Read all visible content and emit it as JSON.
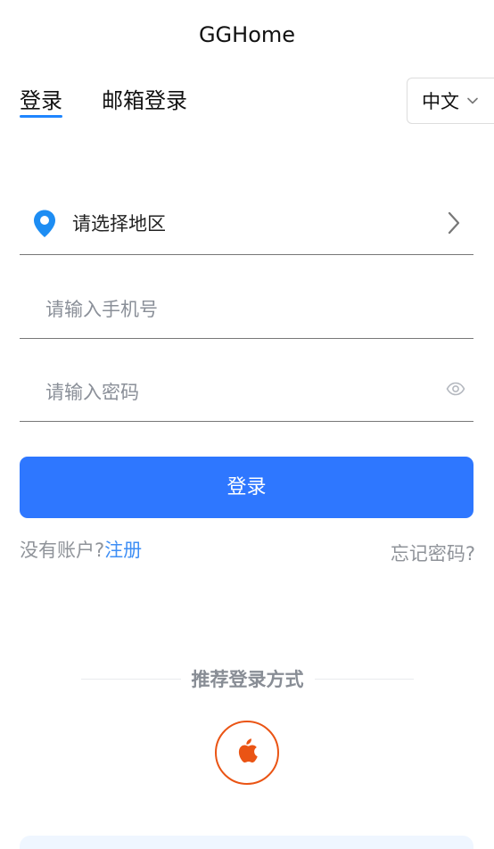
{
  "app": {
    "title": "GGHome"
  },
  "tabs": [
    {
      "label": "登录"
    },
    {
      "label": "邮箱登录"
    }
  ],
  "language": {
    "selected": "中文"
  },
  "form": {
    "region_placeholder": "请选择地区",
    "phone_placeholder": "请输入手机号",
    "password_placeholder": "请输入密码",
    "login_button": "登录"
  },
  "links": {
    "register_prompt": "没有账户?",
    "register_label": "注册",
    "forgot_password": "忘记密码?"
  },
  "recommendation": {
    "title": "推荐登录方式"
  },
  "colors": {
    "primary": "#2e77ff",
    "tab_indicator": "#1f86ff",
    "link": "#3f8ff5",
    "apple_accent": "#ea5414"
  },
  "icons": {
    "region": "location-pin-icon",
    "region_arrow": "chevron-right-icon",
    "language_chevron": "chevron-down-icon",
    "password_toggle": "eye-icon",
    "social_login": "apple-icon"
  }
}
